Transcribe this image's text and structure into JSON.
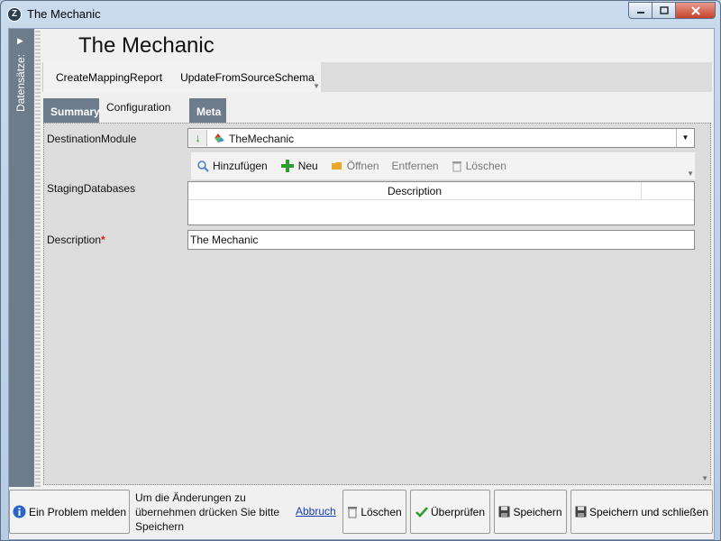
{
  "window": {
    "title": "The Mechanic",
    "app_icon": "Z"
  },
  "sidebar": {
    "label": "Datensätze:"
  },
  "page": {
    "title": "The Mechanic"
  },
  "commands": [
    {
      "label": "CreateMappingReport"
    },
    {
      "label": "UpdateFromSourceSchema"
    }
  ],
  "tabs": [
    {
      "label": "Summary",
      "active": false
    },
    {
      "label": "Configuration",
      "active": true
    },
    {
      "label": "Meta",
      "active": false
    }
  ],
  "fields": {
    "destination_module": {
      "label": "DestinationModule",
      "value": "TheMechanic"
    },
    "staging_databases": {
      "label": "StagingDatabases",
      "toolbar": [
        "Hinzufügen",
        "Neu",
        "Öffnen",
        "Entfernen",
        "Löschen"
      ],
      "columns": [
        "Description"
      ]
    },
    "description": {
      "label": "Description",
      "required_mark": "*",
      "value": "The Mechanic"
    }
  },
  "footer": {
    "report_problem": "Ein Problem melden",
    "hint": "Um die Änderungen zu übernehmen drücken Sie bitte Speichern",
    "abort": "Abbruch",
    "delete": "Löschen",
    "validate": "Überprüfen",
    "save": "Speichern",
    "save_close": "Speichern und schließen"
  },
  "colors": {
    "sidebar": "#6d7c8b",
    "tab_inactive": "#6d7c8b",
    "content_bg": "#dcdcdc",
    "required": "#d42020",
    "link": "#1a3fb0"
  }
}
